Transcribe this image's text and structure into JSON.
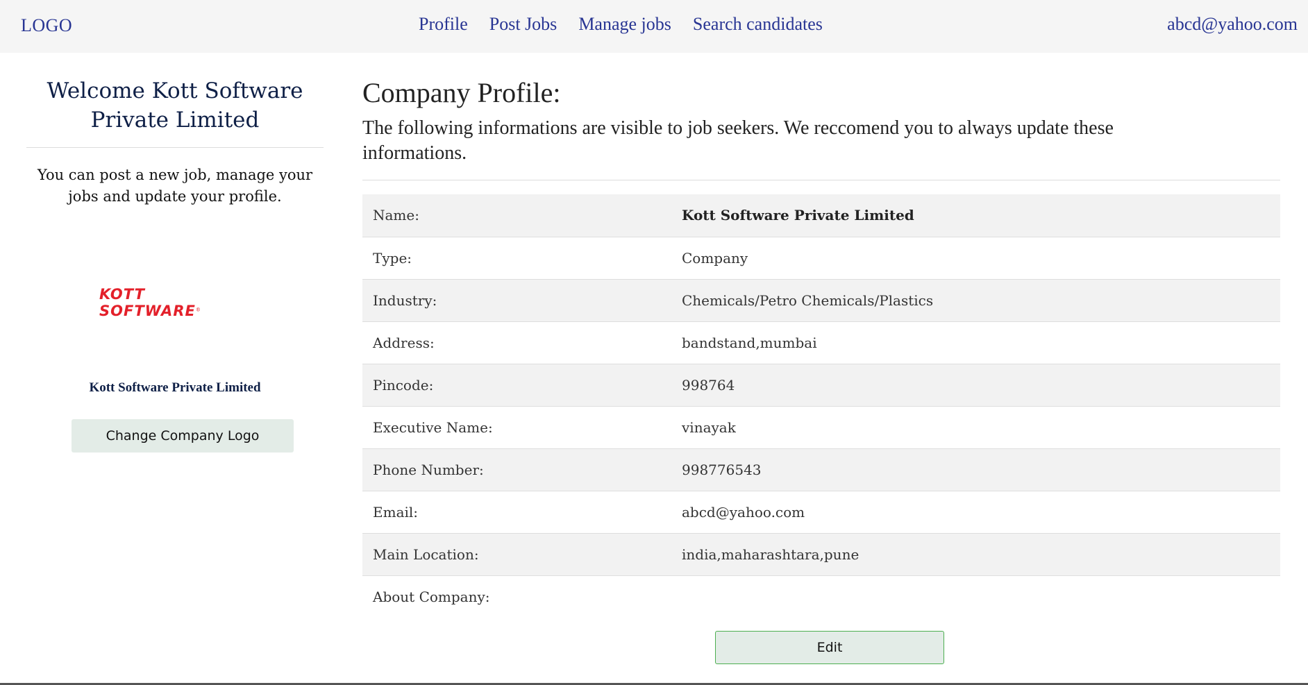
{
  "nav": {
    "logo": "LOGO",
    "links": [
      "Profile",
      "Post Jobs",
      "Manage jobs",
      "Search candidates"
    ],
    "user_email": "abcd@yahoo.com"
  },
  "sidebar": {
    "welcome": "Welcome Kott Software Private Limited",
    "description": "You can post a new job, manage your jobs and update your profile.",
    "logo_text": "KOTT SOFTWARE",
    "logo_mark": "®",
    "company_name": "Kott Software Private Limited",
    "change_logo_label": "Change Company Logo"
  },
  "main": {
    "title": "Company Profile:",
    "description": "The following informations are visible to job seekers. We reccomend you to always update these informations.",
    "rows": [
      {
        "label": "Name:",
        "value": "Kott Software Private Limited"
      },
      {
        "label": "Type:",
        "value": "Company"
      },
      {
        "label": "Industry:",
        "value": "Chemicals/Petro Chemicals/Plastics"
      },
      {
        "label": "Address:",
        "value": "bandstand,mumbai"
      },
      {
        "label": "Pincode:",
        "value": "998764"
      },
      {
        "label": "Executive Name:",
        "value": "vinayak"
      },
      {
        "label": "Phone Number:",
        "value": "998776543"
      },
      {
        "label": "Email:",
        "value": "abcd@yahoo.com"
      },
      {
        "label": "Main Location:",
        "value": "india,maharashtara,pune"
      },
      {
        "label": "About Company:",
        "value": ""
      }
    ],
    "edit_label": "Edit"
  },
  "colors": {
    "nav_text": "#283593",
    "heading": "#0e1f46",
    "logo_red": "#e3202a",
    "button_bg": "#e3ece7",
    "row_stripe": "#f2f2f2"
  }
}
